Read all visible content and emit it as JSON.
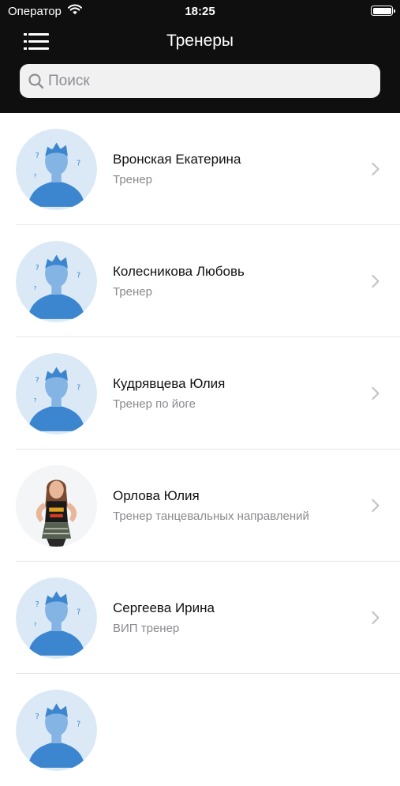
{
  "status_bar": {
    "carrier": "Оператор",
    "time": "18:25"
  },
  "nav": {
    "title": "Тренеры",
    "menu_icon": "menu-icon"
  },
  "search": {
    "placeholder": "Поиск",
    "value": ""
  },
  "colors": {
    "header_bg": "#0f0f0f",
    "avatar_bg": "#dbe9f7",
    "avatar_person": "#3c86cf",
    "secondary_text": "#8a8a8e"
  },
  "trainers": [
    {
      "name": "Вронская Екатерина",
      "role": "Тренер",
      "avatar": "placeholder"
    },
    {
      "name": "Колесникова Любовь",
      "role": "Тренер",
      "avatar": "placeholder"
    },
    {
      "name": "Кудрявцева Юлия",
      "role": "Тренер по йоге",
      "avatar": "placeholder"
    },
    {
      "name": "Орлова Юлия",
      "role": "Тренер танцевальных направлений",
      "avatar": "photo"
    },
    {
      "name": "Сергеева Ирина",
      "role": "ВИП тренер",
      "avatar": "placeholder"
    },
    {
      "name": "",
      "role": "",
      "avatar": "placeholder"
    }
  ]
}
